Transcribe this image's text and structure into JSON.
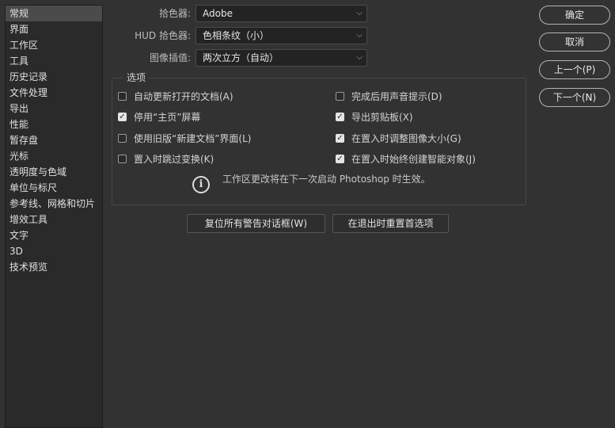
{
  "sidebar": {
    "items": [
      {
        "label": "常规"
      },
      {
        "label": "界面"
      },
      {
        "label": "工作区"
      },
      {
        "label": "工具"
      },
      {
        "label": "历史记录"
      },
      {
        "label": "文件处理"
      },
      {
        "label": "导出"
      },
      {
        "label": "性能"
      },
      {
        "label": "暂存盘"
      },
      {
        "label": "光标"
      },
      {
        "label": "透明度与色域"
      },
      {
        "label": "单位与标尺"
      },
      {
        "label": "参考线、网格和切片"
      },
      {
        "label": "增效工具"
      },
      {
        "label": "文字"
      },
      {
        "label": "3D"
      },
      {
        "label": "技术预览"
      }
    ]
  },
  "general": {
    "color_picker": {
      "label": "拾色器:",
      "value": "Adobe"
    },
    "hud_color_picker": {
      "label": "HUD 拾色器:",
      "value": "色相条纹（小）"
    },
    "image_interpolation": {
      "label": "图像插值:",
      "value": "两次立方（自动）"
    }
  },
  "options": {
    "legend": "选项",
    "left": [
      {
        "label": "自动更新打开的文档(A)",
        "checked": false
      },
      {
        "label": "停用“主页”屏幕",
        "checked": true
      },
      {
        "label": "使用旧版“新建文档”界面(L)",
        "checked": false
      },
      {
        "label": "置入时跳过变换(K)",
        "checked": false
      }
    ],
    "right": [
      {
        "label": "完成后用声音提示(D)",
        "checked": false
      },
      {
        "label": "导出剪贴板(X)",
        "checked": true
      },
      {
        "label": "在置入时调整图像大小(G)",
        "checked": true
      },
      {
        "label": "在置入时始终创建智能对象(J)",
        "checked": true
      }
    ],
    "info_text": "工作区更改将在下一次启动 Photoshop 时生效。"
  },
  "buttons": {
    "reset_warnings": "复位所有警告对话框(W)",
    "reset_on_quit": "在退出时重置首选项",
    "ok": "确定",
    "cancel": "取消",
    "prev": "上一个(P)",
    "next": "下一个(N)"
  },
  "icons": {
    "info": "info-icon",
    "check": "checkmark-icon",
    "dropdown": "chevron-down-icon"
  }
}
